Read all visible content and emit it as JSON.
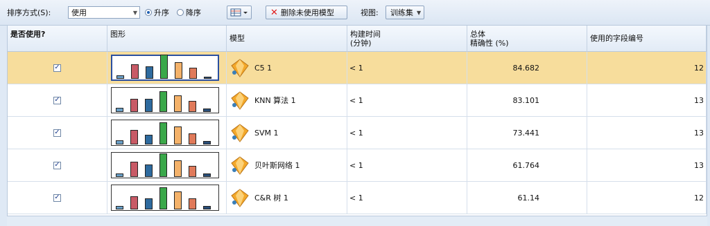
{
  "toolbar": {
    "sort_label": "排序方式(S):",
    "sort_value": "使用",
    "asc_label": "升序",
    "desc_label": "降序",
    "delete_button": "删除未使用模型",
    "view_label": "视图:",
    "view_value": "训练集"
  },
  "columns": {
    "use": "是否使用?",
    "graph": "图形",
    "model": "模型",
    "build_time_1": "构建时间",
    "build_time_2": "(分钟)",
    "accuracy_1": "总体",
    "accuracy_2": "精确性 (%)",
    "fields": "使用的字段编号"
  },
  "rows": [
    {
      "model": "C5 1",
      "time": "< 1",
      "accuracy": "84.682",
      "fields": "12",
      "selected": true
    },
    {
      "model": "KNN 算法 1",
      "time": "< 1",
      "accuracy": "83.101",
      "fields": "13",
      "selected": false
    },
    {
      "model": "SVM 1",
      "time": "< 1",
      "accuracy": "73.441",
      "fields": "13",
      "selected": false
    },
    {
      "model": "贝叶斯网络 1",
      "time": "< 1",
      "accuracy": "61.764",
      "fields": "13",
      "selected": false
    },
    {
      "model": "C&R 树 1",
      "time": "< 1",
      "accuracy": "61.14",
      "fields": "12",
      "selected": false
    }
  ],
  "icons": {
    "delete": "delete-x-icon",
    "view_toggle": "table-view-icon",
    "model": "model-nugget-icon"
  },
  "colors": {
    "selected_row": "#f7dd9c",
    "bar_colors": [
      "#6aa0c8",
      "#c85a66",
      "#2e6a9e",
      "#3aa84a",
      "#f4b26a",
      "#e07a5a",
      "#2a4f7a"
    ]
  }
}
